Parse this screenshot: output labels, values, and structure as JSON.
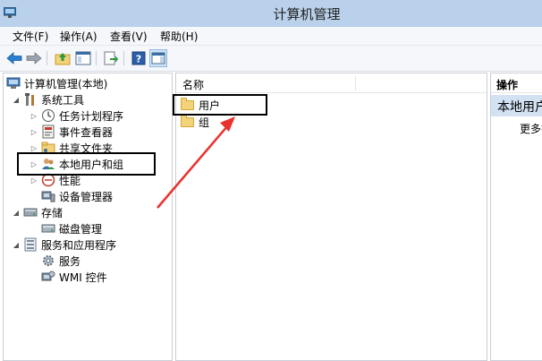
{
  "window": {
    "title": "计算机管理"
  },
  "menu": {
    "file": "文件(F)",
    "action": "操作(A)",
    "view": "查看(V)",
    "help": "帮助(H)"
  },
  "toolbar": {
    "buttons": [
      "back-arrow-icon",
      "forward-arrow-icon",
      "up-folder-icon",
      "show-hide-tree-icon",
      "export-icon",
      "help-icon",
      "show-hide-action-pane-icon"
    ]
  },
  "tree": {
    "root": "计算机管理(本地)",
    "system_tools": "系统工具",
    "task_scheduler": "任务计划程序",
    "event_viewer": "事件查看器",
    "shared_folders": "共享文件夹",
    "local_users_groups": "本地用户和组",
    "performance": "性能",
    "device_manager": "设备管理器",
    "storage": "存储",
    "disk_management": "磁盘管理",
    "services_apps": "服务和应用程序",
    "services": "服务",
    "wmi_control": "WMI 控件"
  },
  "list": {
    "column_name": "名称",
    "items": [
      "用户",
      "组"
    ]
  },
  "actions": {
    "header": "操作",
    "section": "本地用户和组",
    "more": "更多操作"
  },
  "colors": {
    "titlebar": "#b9d1ea",
    "annotation_arrow": "#e8322f",
    "annotation_box": "#000000"
  }
}
